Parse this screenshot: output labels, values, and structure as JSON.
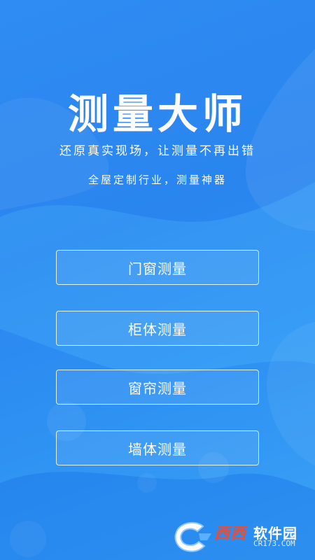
{
  "app": {
    "title": "测量大师",
    "slogan_line1": "还原真实现场，让测量不再出错",
    "slogan_line2": "全屋定制行业，测量神器"
  },
  "menu": {
    "items": [
      {
        "label": "门窗测量"
      },
      {
        "label": "柜体测量"
      },
      {
        "label": "窗帘测量"
      },
      {
        "label": "墙体测量"
      }
    ]
  },
  "watermark": {
    "brand": "西西",
    "site": "软件园",
    "url": "CR173.COM"
  },
  "colors": {
    "background": "#2f8cf2",
    "text": "#ffffff",
    "watermark_brand": "#f24a2c"
  }
}
